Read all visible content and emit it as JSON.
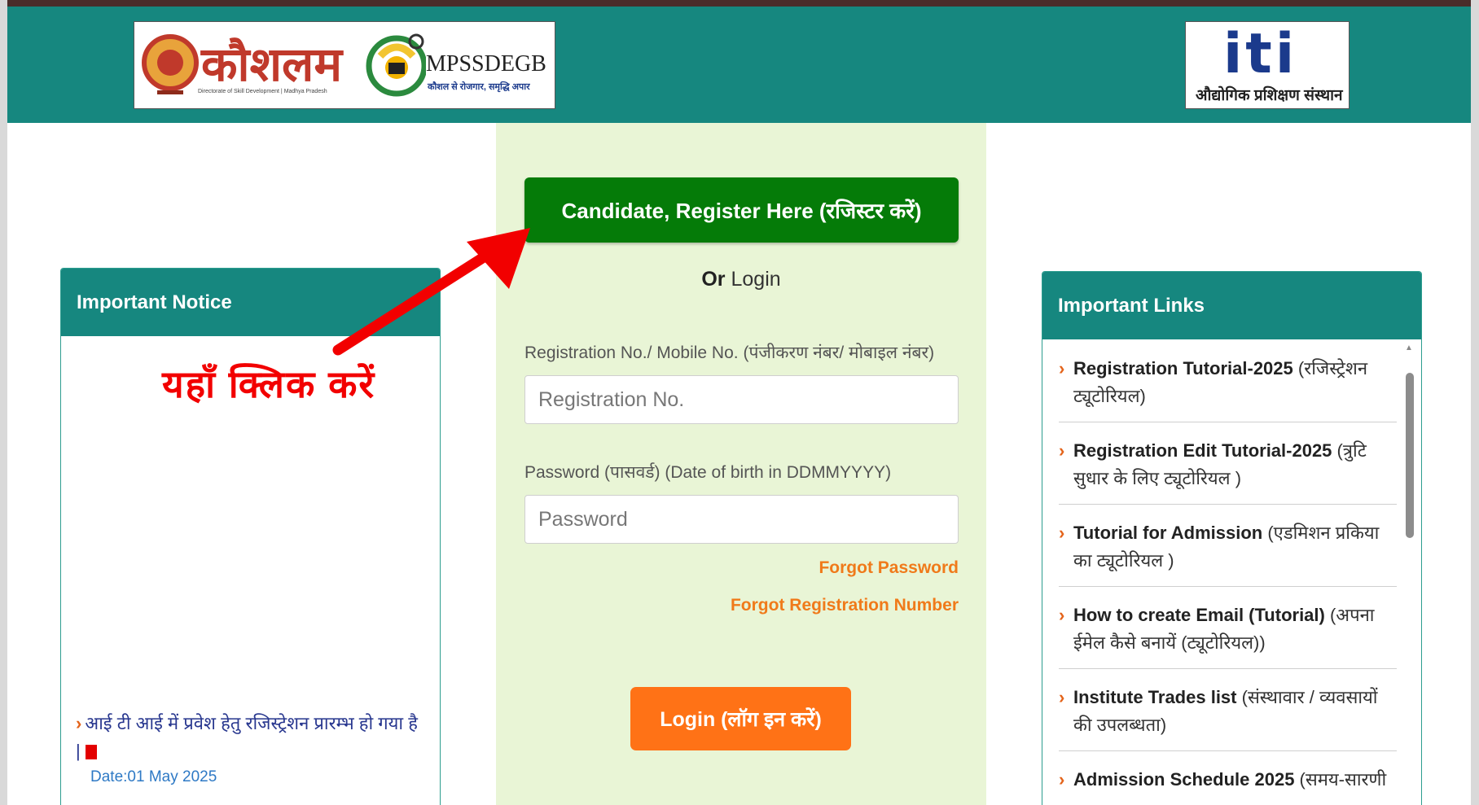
{
  "header": {
    "logo_left_brand": "कौशलम",
    "logo_left_subtext": "Directorate of Skill Development | Madhya Pradesh",
    "logo_mid_brand": "MPSSDEGB",
    "logo_mid_tagline": "कौशल से रोजगार, समृद्धि अपार",
    "logo_right_brand": "iti",
    "logo_right_caption": "औद्योगिक प्रशिक्षण संस्थान"
  },
  "login_panel": {
    "register_button": "Candidate, Register Here (रजिस्टर करें)",
    "or_text": "Or",
    "login_text": "Login",
    "registration_label": "Registration No./ Mobile No. (पंजीकरण नंबर/ मोबाइल नंबर)",
    "registration_placeholder": "Registration No.",
    "password_label": "Password (पासवर्ड) (Date of birth in DDMMYYYY)",
    "password_placeholder": "Password",
    "forgot_password": "Forgot Password",
    "forgot_registration": "Forgot Registration Number",
    "login_button": "Login (लॉग इन करें)"
  },
  "notice_panel": {
    "title": "Important Notice",
    "items": [
      {
        "text": "आई टी आई में प्रवेश हेतु रजिस्ट्रेशन प्रारम्भ हो गया है |",
        "date": "Date:01 May 2025"
      }
    ]
  },
  "links_panel": {
    "title": "Important Links",
    "items": [
      {
        "bold": "Registration Tutorial-2025",
        "rest": " (रजिस्ट्रेशन ट्यूटोरियल)"
      },
      {
        "bold": "Registration Edit Tutorial-2025",
        "rest": " (त्रुटि सुधार के लिए ट्यूटोरियल )"
      },
      {
        "bold": "Tutorial for Admission",
        "rest": " (एडमिशन प्रकिया का ट्यूटोरियल )"
      },
      {
        "bold": "How to create Email (Tutorial)",
        "rest": " (अपना ईमेल कैसे बनायें (ट्यूटोरियल))"
      },
      {
        "bold": "Institute Trades list",
        "rest": " (संस्थावार / व्यवसायों की उपलब्धता)"
      },
      {
        "bold": "Admission Schedule 2025",
        "rest": " (समय-सारणी"
      }
    ]
  },
  "annotation": {
    "text": "यहाँ क्लिक करें",
    "arrow_color": "#f20000"
  },
  "colors": {
    "header_teal": "#16877f",
    "register_green": "#057b08",
    "login_orange": "#ff7216",
    "link_orange": "#f07a1a",
    "center_bg": "#e9f5d6"
  }
}
